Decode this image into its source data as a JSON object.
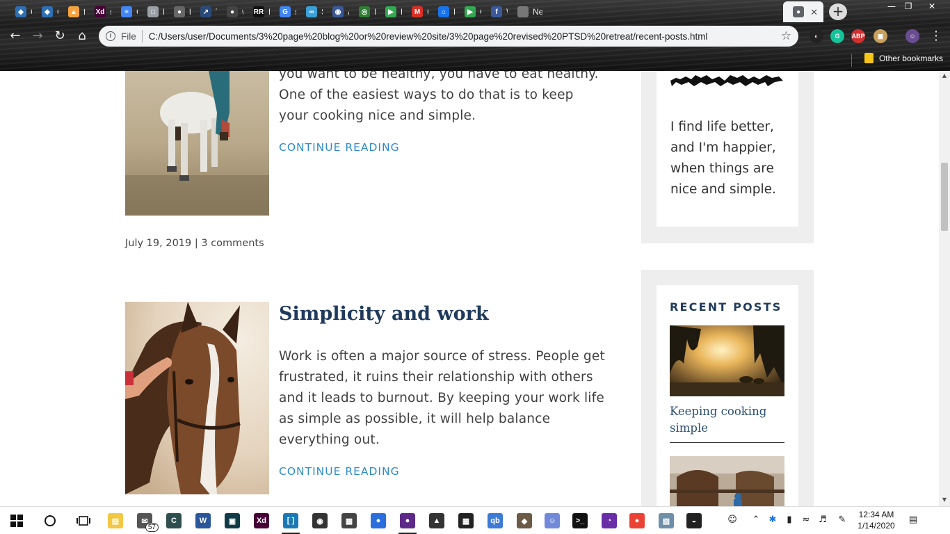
{
  "browser": {
    "tabs": [
      {
        "label": "On",
        "color": "#2f6fb3",
        "glyph": "◆"
      },
      {
        "label": "On",
        "color": "#2f6fb3",
        "glyph": "◆"
      },
      {
        "label": "fle",
        "color": "#f4a340",
        "glyph": "▲"
      },
      {
        "label": "spl",
        "color": "#470137",
        "glyph": "Xd"
      },
      {
        "label": "Co",
        "color": "#4285f4",
        "glyph": "≡"
      },
      {
        "label": "Fro",
        "color": "#9aa0a6",
        "glyph": "□"
      },
      {
        "label": "he",
        "color": "#666",
        "glyph": "●"
      },
      {
        "label": "Th",
        "color": "#2a4a7a",
        "glyph": "↗"
      },
      {
        "label": "wv",
        "color": "#444",
        "glyph": "●"
      },
      {
        "label": "Ne",
        "color": "#111",
        "glyph": "RR"
      },
      {
        "label": "sin",
        "color": "#4285f4",
        "glyph": "G"
      },
      {
        "label": "Sin",
        "color": "#3aa0d8",
        "glyph": "∞"
      },
      {
        "label": "Ab",
        "color": "#3b5998",
        "glyph": "◉"
      },
      {
        "label": "Ex",
        "color": "#2e7d32",
        "glyph": "◎"
      },
      {
        "label": "Bry",
        "color": "#34a853",
        "glyph": "▶"
      },
      {
        "label": "Co",
        "color": "#d93025",
        "glyph": "M"
      },
      {
        "label": "Re",
        "color": "#1a73e8",
        "glyph": "⌂"
      },
      {
        "label": "Go",
        "color": "#34a853",
        "glyph": "▶"
      },
      {
        "label": "Wi",
        "color": "#3b5998",
        "glyph": "f"
      },
      {
        "label": "New Ta",
        "color": "#777",
        "glyph": ""
      }
    ],
    "active_tab_glyph": "●",
    "url_label": "File",
    "url": "C:/Users/user/Documents/3%20page%20blog%20or%20review%20site/3%20page%20revised%20PTSD%20retreat/recent-posts.html",
    "other_bookmarks": "Other bookmarks",
    "extensions": [
      {
        "glyph": "◐",
        "color": "#222"
      },
      {
        "glyph": "G",
        "color": "#15c39a"
      },
      {
        "glyph": "ABP",
        "color": "#d32f2f"
      },
      {
        "glyph": "▣",
        "color": "#c9a15b"
      },
      {
        "glyph": "☺",
        "color": "#6a4c93"
      }
    ]
  },
  "post1": {
    "excerpt": "you want to be healthy, you have to eat healthy. One of the easiest ways to do that is to keep your cooking nice and simple.",
    "continue": "CONTINUE READING",
    "date": "July 19, 2019",
    "separator": "|",
    "comments": "3 comments"
  },
  "post2": {
    "title": "Simplicity and work",
    "excerpt": "Work is often a major source of stress. People get frustrated, it ruins their relationship with others and it leads to burnout. By keeping your work life as simple as possible, it will help balance everything out.",
    "continue": "CONTINUE READING"
  },
  "sidebar": {
    "quote": "I find life better, and I'm happier, when things are nice and simple.",
    "recent_heading": "RECENT POSTS",
    "recent_posts": [
      {
        "title": "Keeping cooking simple"
      }
    ]
  },
  "taskbar": {
    "apps": [
      {
        "name": "file-explorer-icon",
        "glyph": "▤",
        "color": "#f2c744",
        "active": false
      },
      {
        "name": "mail-icon",
        "glyph": "✉",
        "color": "#555",
        "active": false,
        "badge": "57"
      },
      {
        "name": "app-icon",
        "glyph": "C",
        "color": "#2f4f4f",
        "active": false
      },
      {
        "name": "word-icon",
        "glyph": "W",
        "color": "#2b579a",
        "active": false
      },
      {
        "name": "app-icon",
        "glyph": "▣",
        "color": "#0f3b46",
        "active": false
      },
      {
        "name": "xd-icon",
        "glyph": "Xd",
        "color": "#470137",
        "active": false
      },
      {
        "name": "brackets-icon",
        "glyph": "[ ]",
        "color": "#1b79b5",
        "active": true
      },
      {
        "name": "app-icon",
        "glyph": "◉",
        "color": "#333",
        "active": false
      },
      {
        "name": "app-icon",
        "glyph": "▦",
        "color": "#444",
        "active": false
      },
      {
        "name": "firefox-icon",
        "glyph": "●",
        "color": "#2a6fdb",
        "active": false
      },
      {
        "name": "chrome-icon",
        "glyph": "●",
        "color": "#5e2a8a",
        "active": true
      },
      {
        "name": "inkscape-icon",
        "glyph": "▲",
        "color": "#333",
        "active": false
      },
      {
        "name": "calculator-icon",
        "glyph": "▦",
        "color": "#222",
        "active": false
      },
      {
        "name": "qbittorrent-icon",
        "glyph": "qb",
        "color": "#3c7bd6",
        "active": false
      },
      {
        "name": "gimp-icon",
        "glyph": "◆",
        "color": "#6b5a45",
        "active": false
      },
      {
        "name": "discord-icon",
        "glyph": "☺",
        "color": "#7289da",
        "active": false
      },
      {
        "name": "terminal-icon",
        "glyph": ">_",
        "color": "#111",
        "active": false
      },
      {
        "name": "app-icon",
        "glyph": "◔",
        "color": "#6a2da8",
        "active": false
      },
      {
        "name": "chrome-icon",
        "glyph": "●",
        "color": "#ea4335",
        "active": false
      },
      {
        "name": "app-icon",
        "glyph": "▧",
        "color": "#6f8fa8",
        "active": false
      },
      {
        "name": "app-icon",
        "glyph": "◒",
        "color": "#222",
        "active": false
      }
    ],
    "clock_time": "12:34 AM",
    "clock_date": "1/14/2020"
  }
}
